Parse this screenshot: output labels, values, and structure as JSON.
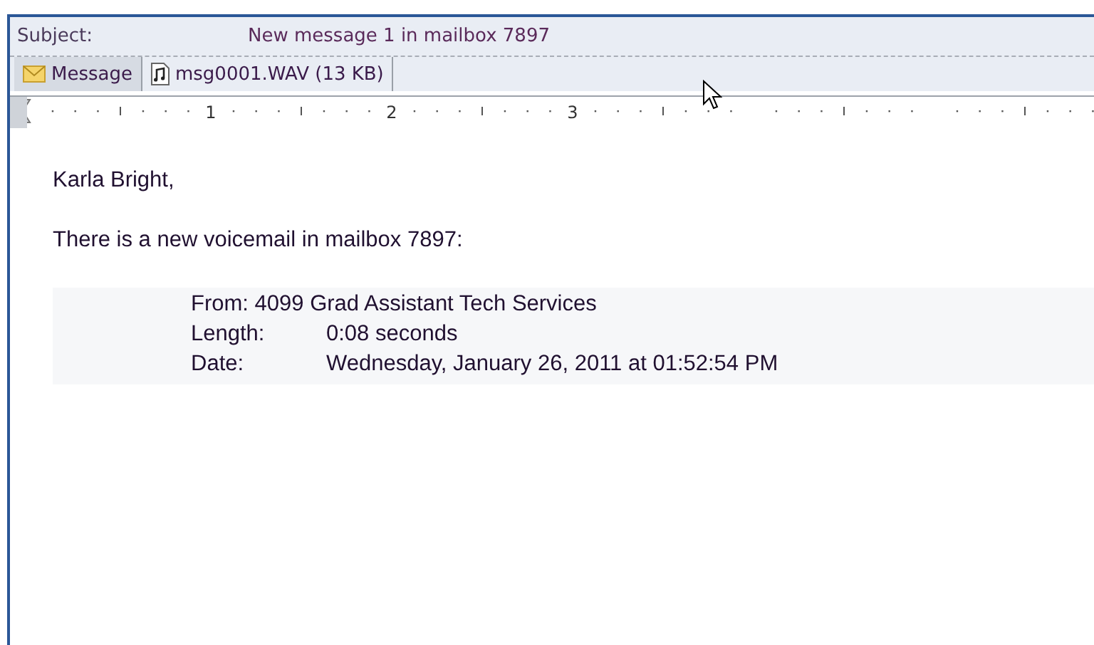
{
  "header": {
    "subject_label": "Subject:",
    "subject": "New message 1 in mailbox 7897"
  },
  "attachments": [
    {
      "kind": "message",
      "label": "Message",
      "selected": true
    },
    {
      "kind": "audio",
      "label": "msg0001.WAV (13 KB)",
      "selected": false
    }
  ],
  "ruler": {
    "labels": [
      "1",
      "2",
      "3"
    ]
  },
  "body": {
    "greeting": "Karla Bright,",
    "intro": "There is a new voicemail in mailbox 7897:",
    "details": [
      {
        "kind": "line",
        "label": "From:",
        "value": "4099 Grad Assistant Tech Services"
      },
      {
        "kind": "field",
        "label": "Length:",
        "value": "0:08 seconds"
      },
      {
        "kind": "field",
        "label": "Date:",
        "value": "Wednesday, January 26, 2011 at 01:52:54 PM"
      }
    ]
  }
}
